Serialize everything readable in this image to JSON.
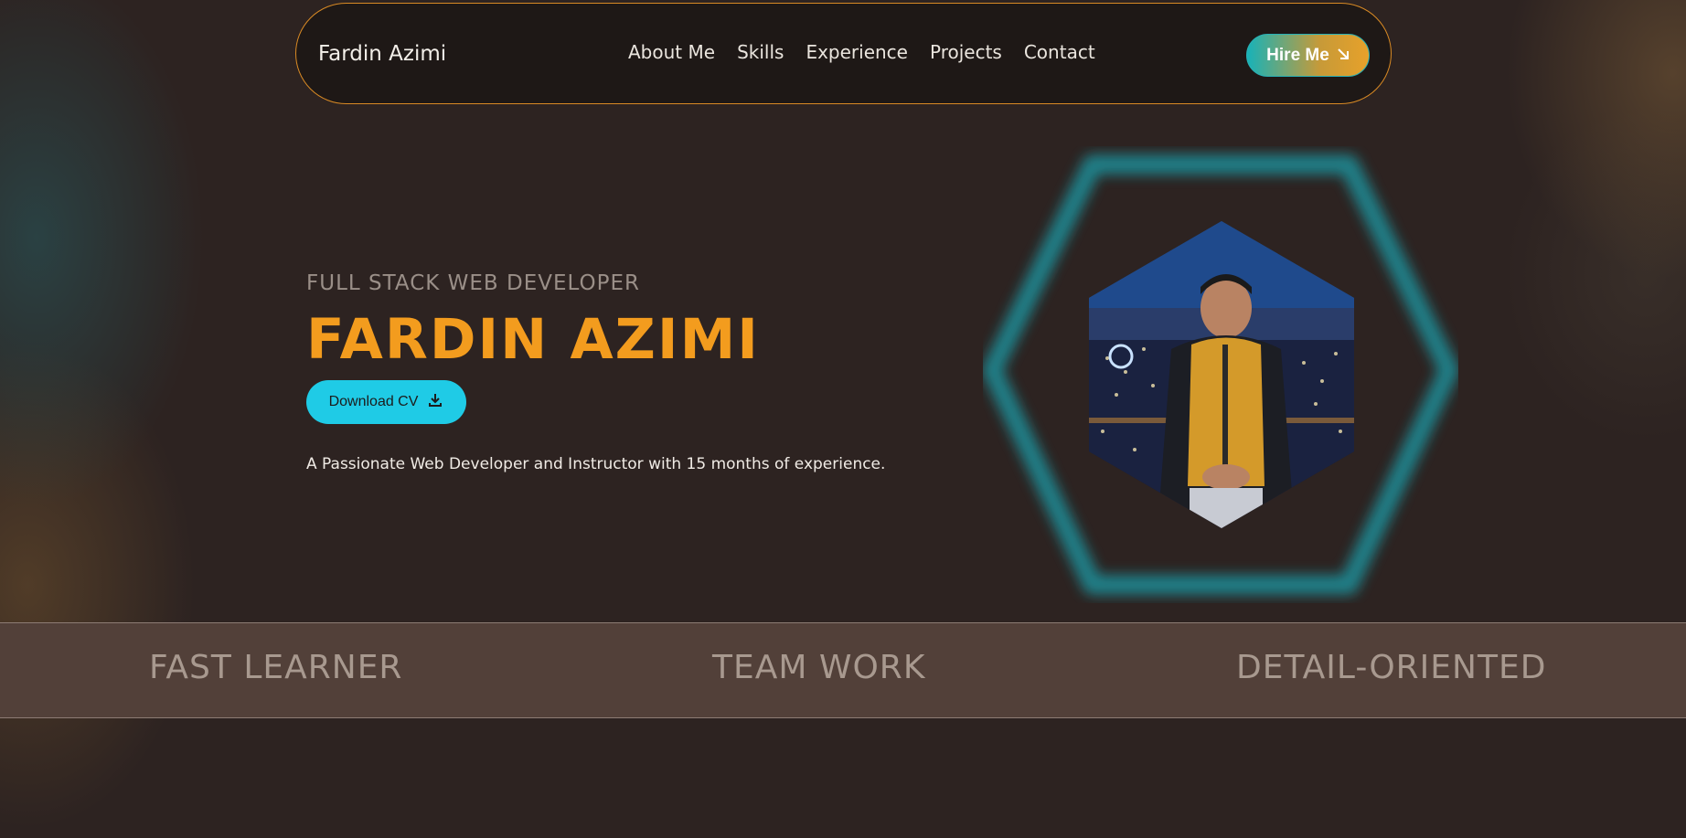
{
  "nav": {
    "brand": "Fardin Azimi",
    "links": [
      "About Me",
      "Skills",
      "Experience",
      "Projects",
      "Contact"
    ],
    "hire_label": "Hire Me"
  },
  "hero": {
    "subtitle": "FULL STACK WEB DEVELOPER",
    "title": "FARDIN AZIMI",
    "cv_label": "Download CV",
    "description": "A Passionate Web Developer and Instructor with 15 months of experience."
  },
  "strip": {
    "items": [
      "FAST LEARNER",
      "TEAM WORK",
      "DETAIL-ORIENTED"
    ]
  },
  "colors": {
    "accent": "#f39c1e",
    "cyan": "#1fcbe6",
    "background": "#2d2321",
    "strip": "#524039"
  },
  "icons": {
    "hire": "arrow-down-right-icon",
    "cv": "download-icon"
  }
}
